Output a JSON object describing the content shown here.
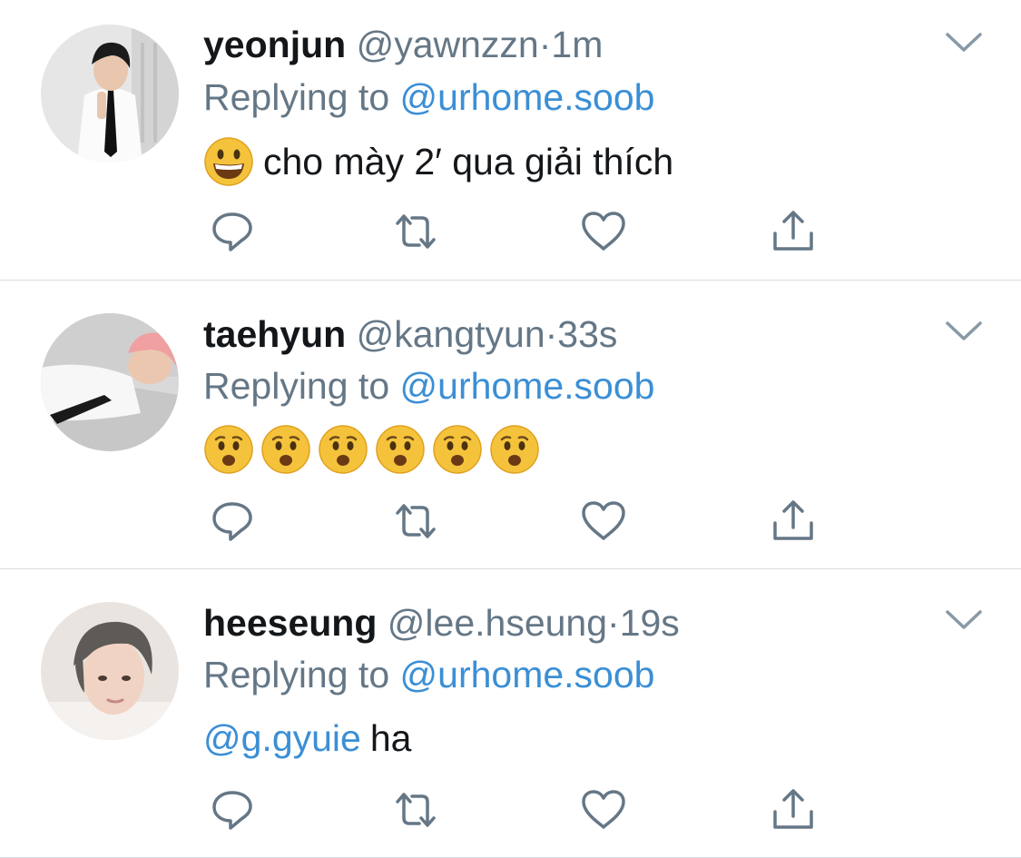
{
  "tweets": [
    {
      "name": "yeonjun",
      "handle": "@yawnzzn",
      "separator": "·",
      "time": "1m",
      "replying_prefix": "Replying to",
      "replying_handle": "@urhome.soob",
      "body_text": "cho mày 2′ qua giải thích",
      "body_emoji": "grinning-face-emoji"
    },
    {
      "name": "taehyun",
      "handle": "@kangtyun",
      "separator": "·",
      "time": "33s",
      "replying_prefix": "Replying to",
      "replying_handle": "@urhome.soob",
      "body_emoji": "hushed-worried-face-emoji x6"
    },
    {
      "name": "heeseung",
      "handle": "@lee.hseung",
      "separator": "·",
      "time": "19s",
      "replying_prefix": "Replying to",
      "replying_handle": "@urhome.soob",
      "body_mention": "@g.gyuie",
      "body_text": "ha"
    }
  ],
  "icons": {
    "reply": "reply-bubble-icon",
    "retweet": "retweet-arrows-icon",
    "like": "heart-outline-icon",
    "share": "share-upload-icon",
    "menu": "chevron-down-icon"
  },
  "colors": {
    "text": "#14171a",
    "secondary": "#657786",
    "link": "#3b8fd5",
    "divider": "#d8dde2"
  }
}
